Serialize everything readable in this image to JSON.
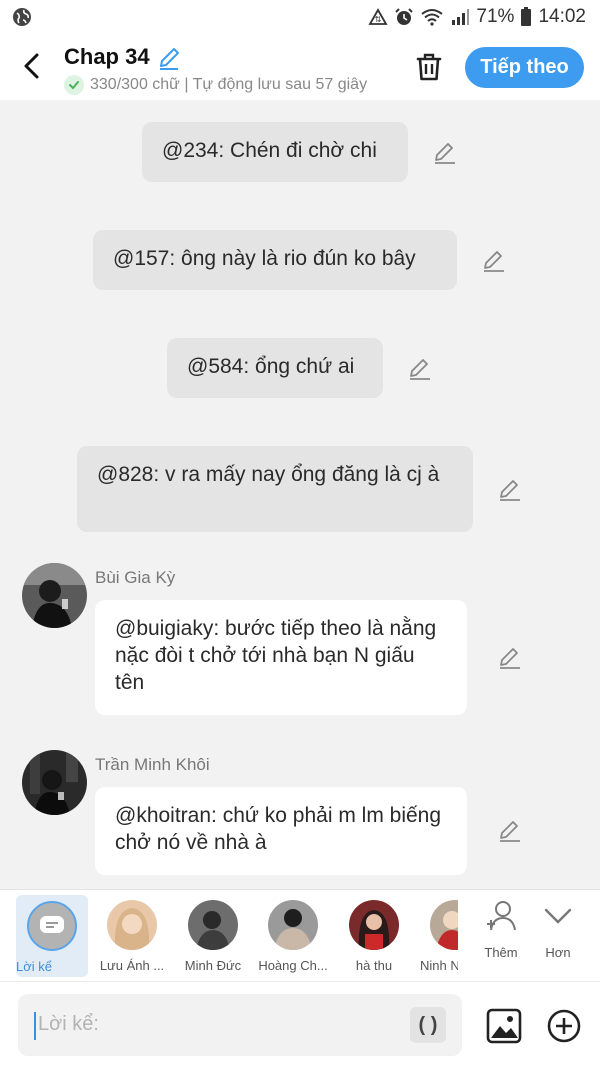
{
  "status_bar": {
    "battery": "71%",
    "time": "14:02"
  },
  "header": {
    "title": "Chap 34",
    "subtitle": "330/300 chữ | Tự động lưu sau 57 giây",
    "next_label": "Tiếp theo"
  },
  "messages": [
    {
      "type": "narration",
      "text": "@234: Chén đi chờ chi"
    },
    {
      "type": "narration",
      "text": "@157: ông này là rio đún ko bây"
    },
    {
      "type": "narration",
      "text": "@584: ổng chứ ai"
    },
    {
      "type": "narration",
      "text": "@828: v ra mấy nay ổng đăng là cj à"
    },
    {
      "type": "character",
      "name": "Bùi Gia Kỳ",
      "text": "@buigiaky: bước tiếp theo là nằng nặc đòi t chở tới nhà bạn N giấu tên"
    },
    {
      "type": "character",
      "name": "Trần Minh Khôi",
      "text": "@khoitran: chứ ko phải m lm biếng chở nó về nhà à"
    }
  ],
  "characters": [
    {
      "label": "Lời kể",
      "selected": true
    },
    {
      "label": "Lưu Ánh ..."
    },
    {
      "label": "Minh Đức"
    },
    {
      "label": "Hoàng Ch..."
    },
    {
      "label": "hà thu"
    },
    {
      "label": "Ninh N"
    }
  ],
  "strip_actions": {
    "add_label": "Thêm",
    "more_label": "Hơn"
  },
  "input": {
    "placeholder": "Lời kể:",
    "paren_label": "( )"
  },
  "icons": {
    "accent": "#3d9cf0",
    "success": "#4cb15a"
  }
}
